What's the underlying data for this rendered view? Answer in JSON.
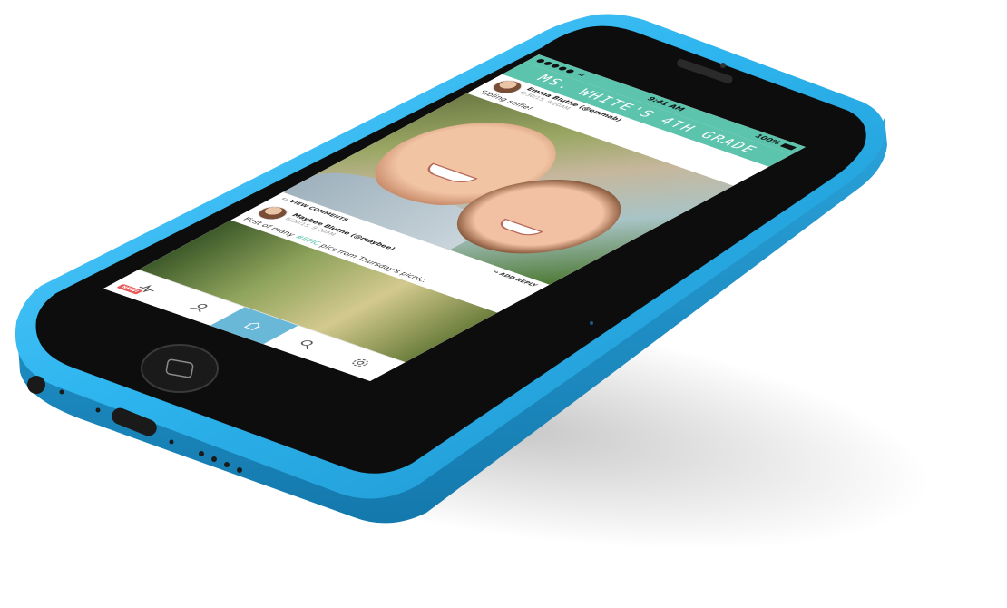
{
  "status": {
    "signal": "●●●●● ≈",
    "time": "9:41 AM",
    "battery": "100%"
  },
  "title": "MS. WHITE'S 4TH GRADE",
  "post1": {
    "author": "Emma Bluthe (@emmab)",
    "time": "6/30/15, 9:20AM",
    "caption": "Sibling selfie!",
    "view_comments": "VIEW COMMENTS",
    "add_reply": "ADD REPLY"
  },
  "post2": {
    "author": "Maybee Bluthe (@maybee)",
    "time": "6/30/15, 9:20AM",
    "caption_pre": "First of many ",
    "hashtag": "#EPIC",
    "caption_post": " pics from Thursday's picnic."
  },
  "tabs": {
    "new_badge": "NEW!",
    "icons": [
      "activity-icon",
      "profile-icon",
      "home-icon",
      "search-icon",
      "settings-icon"
    ]
  },
  "colors": {
    "accent": "#5cc3ad",
    "phone_body": "#38b8f0",
    "tab_active": "#6ab8d8",
    "badge": "#e85a5a"
  }
}
